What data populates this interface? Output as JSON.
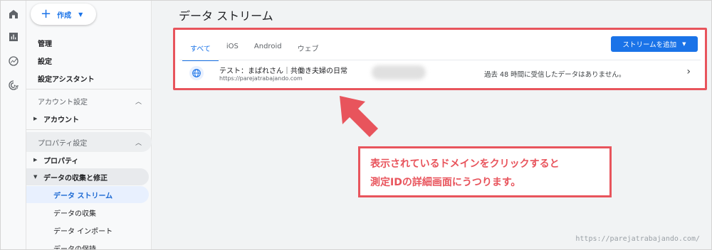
{
  "nav": {
    "create_label": "作成",
    "admin": "管理",
    "settings": "設定",
    "setup_assistant": "設定アシスタント",
    "account_section": "アカウント設定",
    "account_item": "アカウント",
    "property_section": "プロパティ設定",
    "property_item": "プロパティ",
    "data_collection_item": "データの収集と修正",
    "sub_items": [
      "データ ストリーム",
      "データの収集",
      "データ インポート",
      "データの保持"
    ]
  },
  "main": {
    "title": "データ ストリーム",
    "tabs": [
      "すべて",
      "iOS",
      "Android",
      "ウェブ"
    ],
    "add_stream_label": "ストリームを追加",
    "stream": {
      "name": "テスト：まぱれさん｜共働き夫婦の日常",
      "url": "https://parejatrabajando.com",
      "status": "過去 48 時間に受信したデータはありません。"
    }
  },
  "annotation": {
    "line1": "表示されているドメインをクリックすると",
    "line2": "測定IDの詳細画面にうつります。"
  },
  "watermark": "https://parejatrabajando.com/",
  "colors": {
    "accent": "#1a73e8",
    "callout": "#e8545c"
  }
}
